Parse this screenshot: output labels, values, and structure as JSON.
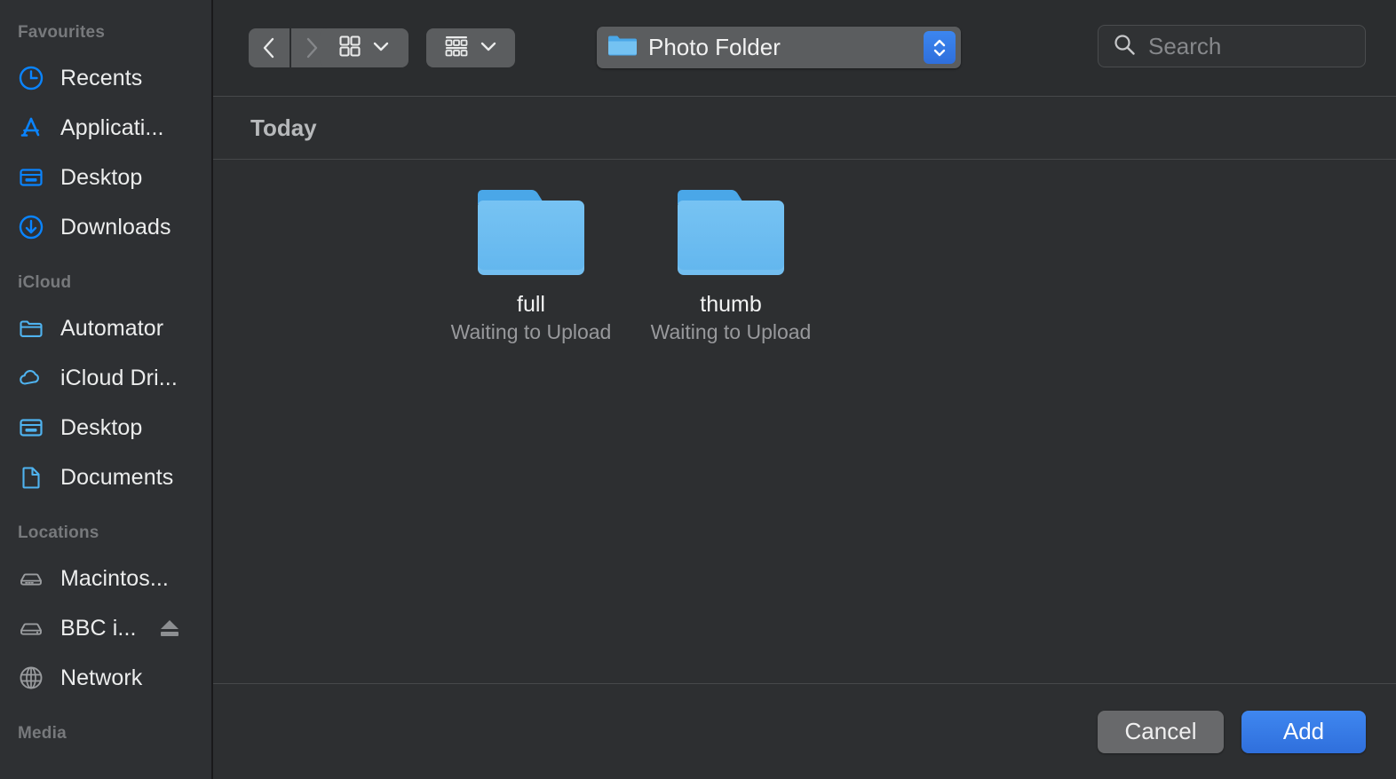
{
  "window": {
    "title": "Photo Folder"
  },
  "sidebar": {
    "sections": [
      {
        "title": "Favourites",
        "items": [
          {
            "label": "Recents",
            "icon": "clock-icon",
            "tint": "#0a84ff"
          },
          {
            "label": "Applicati...",
            "icon": "applications-icon",
            "tint": "#0a84ff"
          },
          {
            "label": "Desktop",
            "icon": "desktop-icon",
            "tint": "#0a84ff"
          },
          {
            "label": "Downloads",
            "icon": "downloads-icon",
            "tint": "#0a84ff"
          }
        ]
      },
      {
        "title": "iCloud",
        "items": [
          {
            "label": "Automator",
            "icon": "folder-icon",
            "tint": "#4fb3f0"
          },
          {
            "label": "iCloud Dri...",
            "icon": "cloud-icon",
            "tint": "#4fb3f0"
          },
          {
            "label": "Desktop",
            "icon": "desktop-icon",
            "tint": "#4fb3f0"
          },
          {
            "label": "Documents",
            "icon": "document-icon",
            "tint": "#4fb3f0"
          }
        ]
      },
      {
        "title": "Locations",
        "items": [
          {
            "label": "Macintos...",
            "icon": "hard-drive-icon",
            "tint": "#9a9c9f"
          },
          {
            "label": "BBC i...",
            "icon": "external-drive-icon",
            "tint": "#9a9c9f",
            "eject": true
          },
          {
            "label": "Network",
            "icon": "globe-icon",
            "tint": "#9a9c9f"
          }
        ]
      },
      {
        "title": "Media",
        "items": []
      }
    ]
  },
  "toolbar": {
    "back_label": "Back",
    "forward_label": "Forward",
    "view_mode": "icon-view",
    "group_mode": "group-by",
    "path_label": "Photo Folder"
  },
  "search": {
    "placeholder": "Search",
    "value": ""
  },
  "content": {
    "group_header": "Today",
    "files": [
      {
        "name": "full",
        "status": "Waiting to Upload",
        "kind": "folder"
      },
      {
        "name": "thumb",
        "status": "Waiting to Upload",
        "kind": "folder"
      }
    ]
  },
  "footer": {
    "cancel_label": "Cancel",
    "add_label": "Add"
  },
  "colors": {
    "accent": "#3478f6",
    "folder": "#62b6ee",
    "sidebar_blue": "#0a84ff",
    "icloud_blue": "#4fb3f0"
  }
}
